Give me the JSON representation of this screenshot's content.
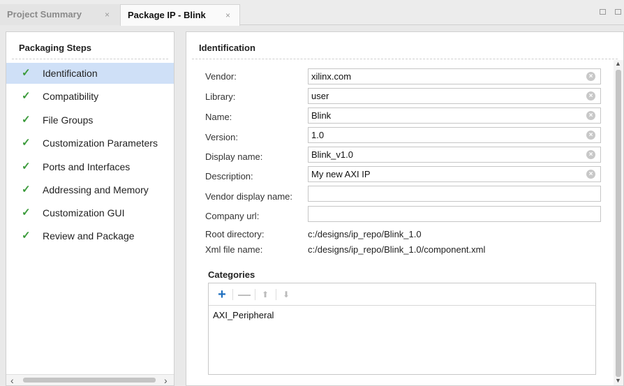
{
  "tabs": [
    {
      "label": "Project Summary",
      "close": "×"
    },
    {
      "label": "Package IP - Blink",
      "close": "×"
    }
  ],
  "left_panel": {
    "title": "Packaging Steps",
    "check_glyph": "✓",
    "steps": [
      {
        "label": "Identification",
        "selected": true
      },
      {
        "label": "Compatibility"
      },
      {
        "label": "File Groups"
      },
      {
        "label": "Customization Parameters"
      },
      {
        "label": "Ports and Interfaces"
      },
      {
        "label": "Addressing and Memory"
      },
      {
        "label": "Customization GUI"
      },
      {
        "label": "Review and Package"
      }
    ]
  },
  "identification": {
    "title": "Identification",
    "fields": [
      {
        "label": "Vendor:",
        "value": "xilinx.com"
      },
      {
        "label": "Library:",
        "value": "user"
      },
      {
        "label": "Name:",
        "value": "Blink"
      },
      {
        "label": "Version:",
        "value": "1.0"
      },
      {
        "label": "Display name:",
        "value": "Blink_v1.0"
      },
      {
        "label": "Description:",
        "value": "My new AXI IP"
      },
      {
        "label": "Vendor display name:",
        "value": ""
      },
      {
        "label": "Company url:",
        "value": ""
      }
    ],
    "root_directory": {
      "label": "Root directory:",
      "value": "c:/designs/ip_repo/Blink_1.0"
    },
    "xml_file_name": {
      "label": "Xml file name:",
      "value": "c:/designs/ip_repo/Blink_1.0/component.xml"
    }
  },
  "categories": {
    "title": "Categories",
    "tools": {
      "add": "+",
      "remove": "—",
      "up": "⬆",
      "down": "⬇"
    },
    "items": [
      "AXI_Peripheral"
    ]
  },
  "colors": {
    "selected_row": "#cfe0f7",
    "check_green": "#3a9a3a",
    "add_blue": "#1f6fbf"
  }
}
